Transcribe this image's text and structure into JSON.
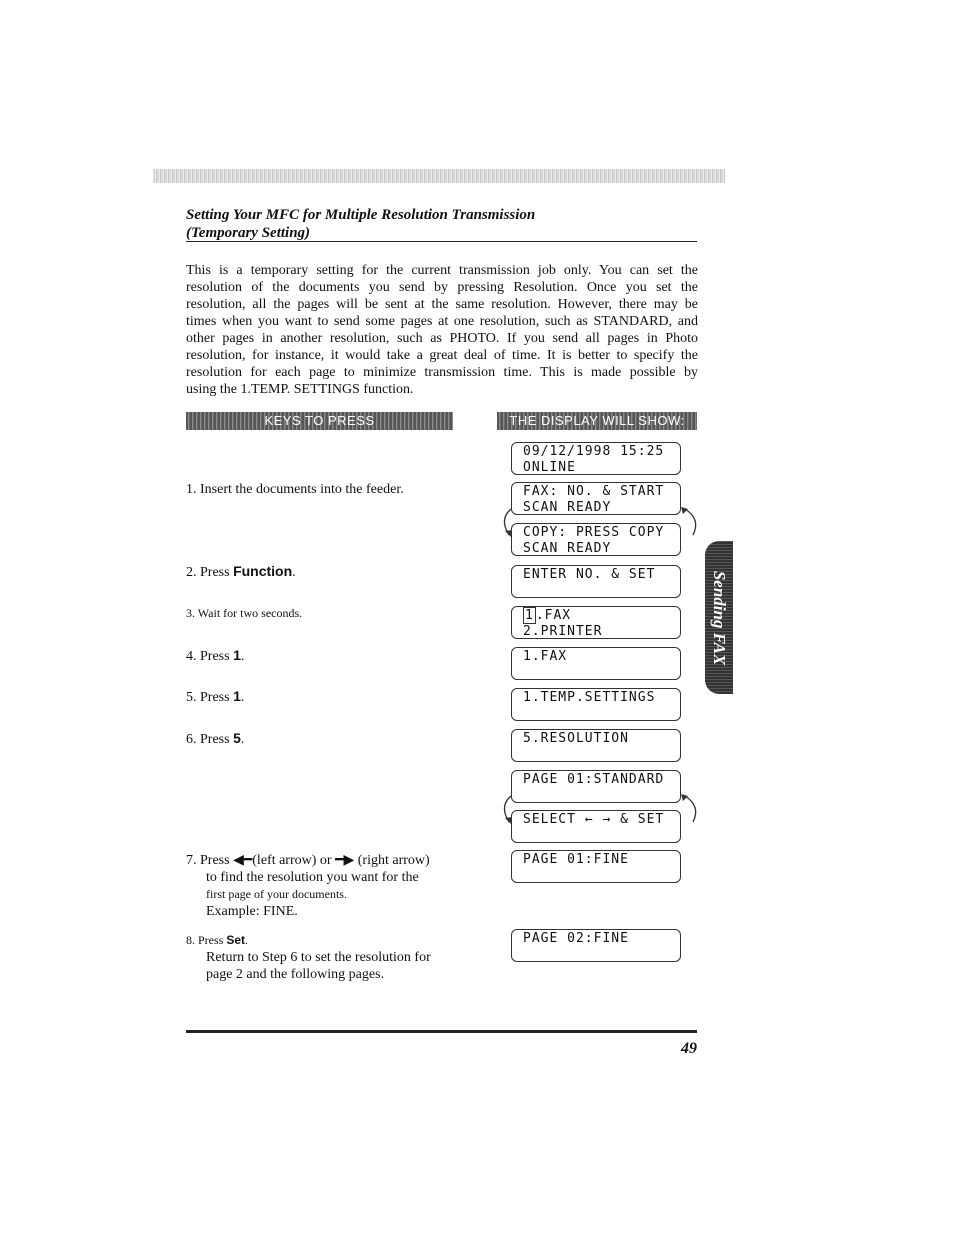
{
  "title": {
    "line1": "Setting Your MFC for Multiple Resolution Transmission",
    "line2": "(Temporary Setting)"
  },
  "intro_lines": [
    "This is a temporary setting for the current transmission job only. You can set the",
    "resolution of the documents you send by pressing Resolution. Once you set the",
    "resolution, all the pages will be sent at the same resolution. However, there may be",
    "times when you want to send some pages at one resolution, such as STANDARD, and",
    "other pages in another resolution, such as PHOTO. If you send all pages in Photo",
    "resolution, for instance, it would take a great deal of time. It is better to specify the",
    "resolution for each page to minimize transmission time. This is made possible by",
    "using the 1.TEMP. SETTINGS function."
  ],
  "headers": {
    "keys": "KEYS TO PRESS",
    "display": "THE DISPLAY WILL SHOW:"
  },
  "steps": [
    {
      "num": "1.",
      "text": "Insert the documents into the feeder."
    },
    {
      "num": "2.",
      "pre": "Press ",
      "key": "Function",
      "post": "."
    },
    {
      "num": "3.",
      "text": "Wait for two seconds."
    },
    {
      "num": "4.",
      "pre": "Press ",
      "key": "1",
      "post": "."
    },
    {
      "num": "5.",
      "pre": "Press ",
      "key": "1",
      "post": "."
    },
    {
      "num": "6.",
      "pre": "Press ",
      "key": "5",
      "post": "."
    },
    {
      "num": "7.",
      "pre": "Press ",
      "left": "(left arrow) or ",
      "right": "(right arrow)",
      "line2": "to find the resolution you want for the",
      "line3": "first page of your documents.",
      "line4": "Example: FINE."
    },
    {
      "num": "8.",
      "pre": "Press ",
      "key": "Set",
      "post": ".",
      "line2": "Return to Step 6 to set the resolution for",
      "line3": "page 2 and the following pages."
    }
  ],
  "displays": [
    {
      "l1": "09/12/1998 15:25",
      "l2": "ONLINE"
    },
    {
      "l1": "FAX: NO. & START",
      "l2": "SCAN READY"
    },
    {
      "l1": "COPY: PRESS COPY",
      "l2": "SCAN READY"
    },
    {
      "l1": "ENTER NO. & SET",
      "l2": ""
    },
    {
      "cursor": "1",
      "l1": ".FAX",
      "l2": "2.PRINTER"
    },
    {
      "l1": "1.FAX",
      "l2": ""
    },
    {
      "l1": "1.TEMP.SETTINGS",
      "l2": ""
    },
    {
      "l1": "5.RESOLUTION",
      "l2": ""
    },
    {
      "l1": "PAGE 01:STANDARD",
      "l2": ""
    },
    {
      "l1": "SELECT ← → & SET",
      "l2": ""
    },
    {
      "l1": "PAGE 01:FINE",
      "l2": ""
    },
    {
      "l1": "PAGE 02:FINE",
      "l2": ""
    }
  ],
  "side_tab": "Sending FAX",
  "page_number": "49"
}
